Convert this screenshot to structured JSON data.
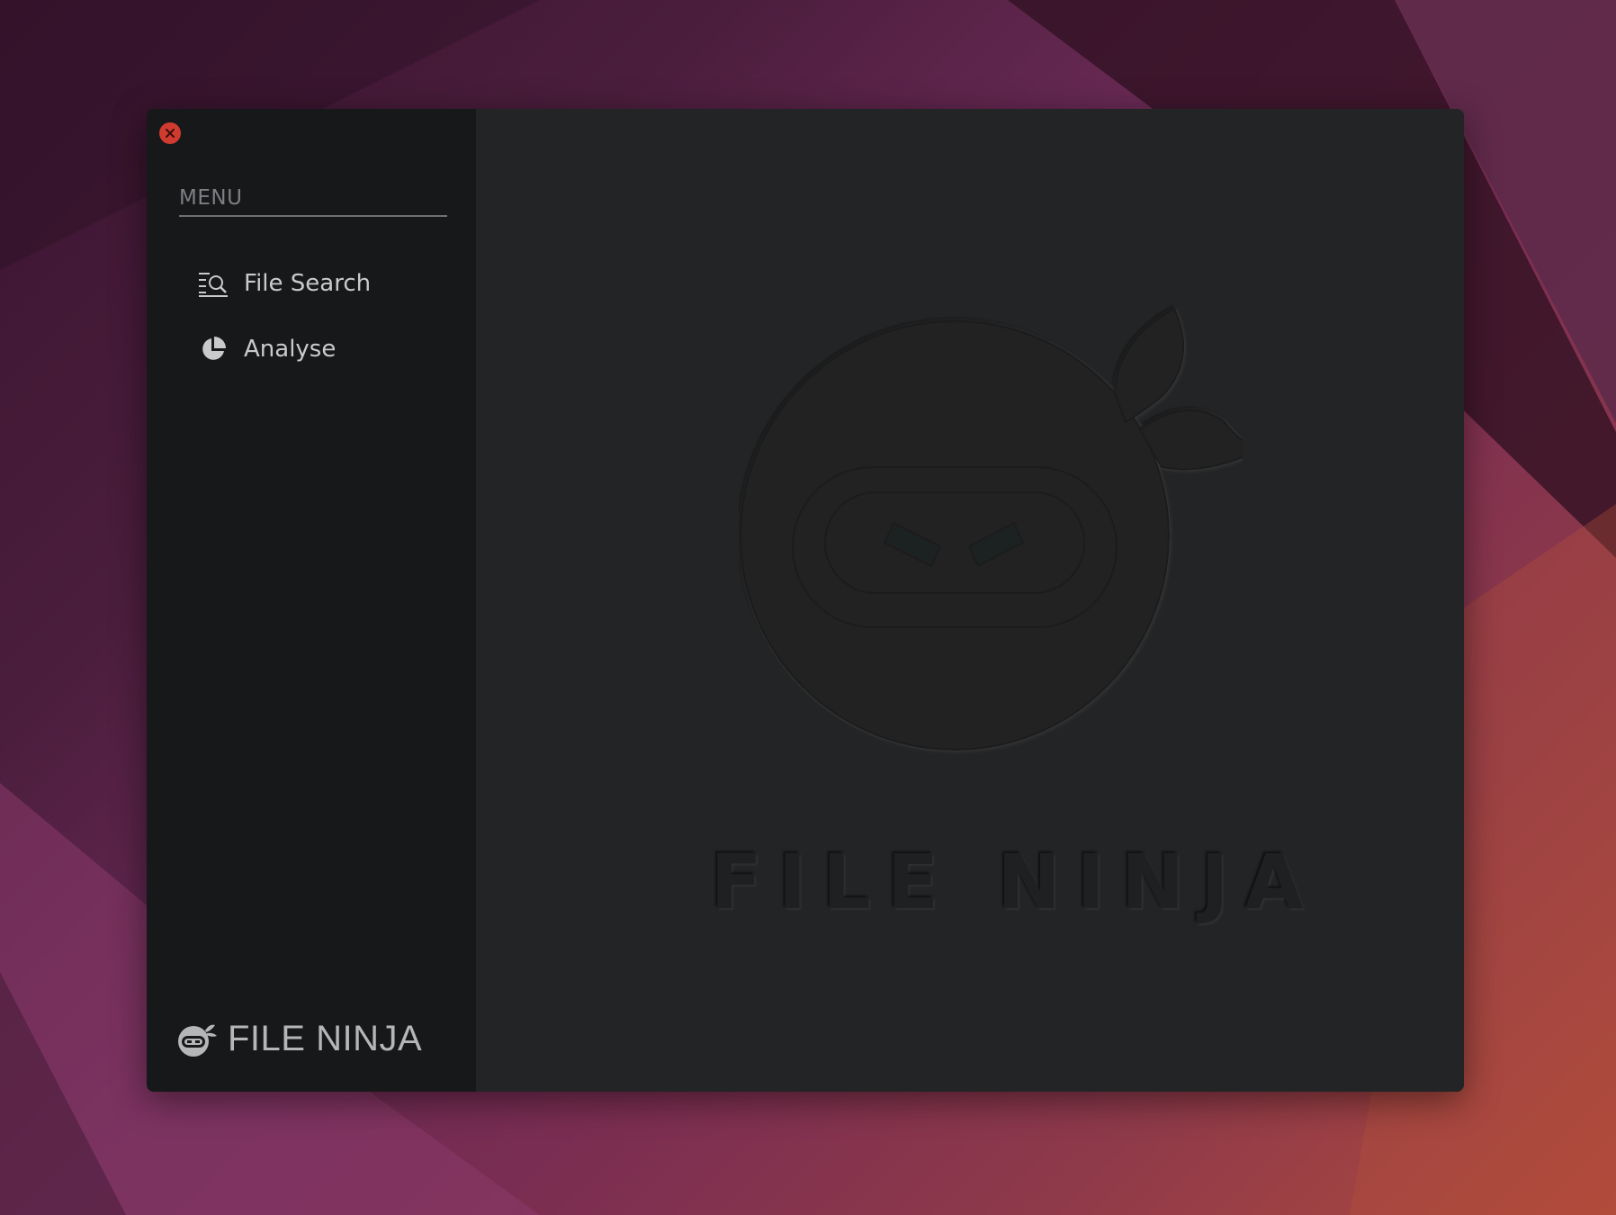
{
  "window": {
    "close_label": "Close"
  },
  "sidebar": {
    "heading": "MENU",
    "items": [
      {
        "label": "File Search",
        "icon": "file-search-icon"
      },
      {
        "label": "Analyse",
        "icon": "pie-chart-icon"
      }
    ],
    "brand": "FILE NINJA"
  },
  "main": {
    "watermark_text": "FILE NINJA"
  },
  "colors": {
    "sidebar_bg": "#17181a",
    "main_bg": "#232425",
    "close_button": "#d03b30",
    "text_primary": "#c9cacc",
    "text_muted": "#7d7f82"
  }
}
